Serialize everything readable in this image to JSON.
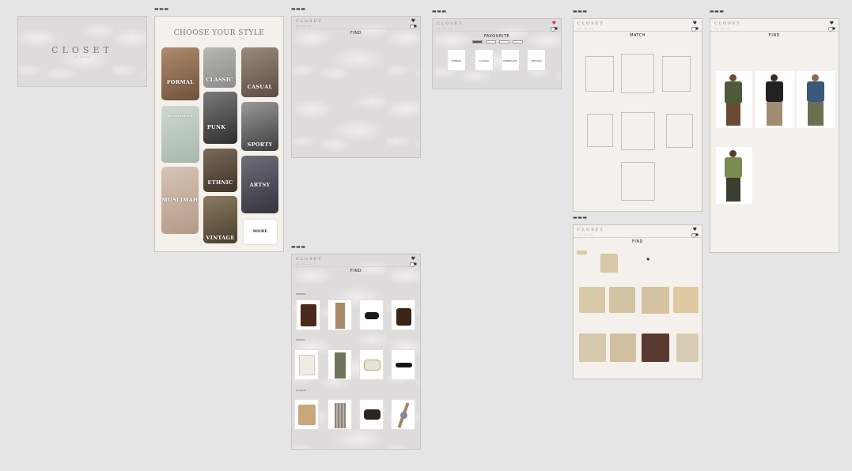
{
  "frames": {
    "splash": {
      "label": "",
      "brand": "CLOSET",
      "brand_sub": "•• •• ••"
    },
    "style": {
      "label": "",
      "title": "CHOOSE YOUR STYLE",
      "tiles": [
        {
          "name": "formal",
          "label": "FORMAL",
          "color": "#8a6a52"
        },
        {
          "name": "classic",
          "label": "CLASSIC",
          "color": "#9a9a96"
        },
        {
          "name": "casual",
          "label": "CASUAL",
          "color": "#7d6d5e"
        },
        {
          "name": "minimalist",
          "label": "MINIMALIST",
          "color": "#b9c7bd"
        },
        {
          "name": "punk",
          "label": "PUNK",
          "color": "#5a5a58"
        },
        {
          "name": "sporty",
          "label": "SPORTY",
          "color": "#6a6a68"
        },
        {
          "name": "muslimah",
          "label": "MUSLIMAH",
          "color": "#c9b3a4"
        },
        {
          "name": "ethnic",
          "label": "ETHNIC",
          "color": "#5b4d3c"
        },
        {
          "name": "artsy",
          "label": "ARTSY",
          "color": "#4f4f58"
        },
        {
          "name": "vintage",
          "label": "VINTAGE",
          "color": "#6a5a44"
        },
        {
          "name": "more",
          "label": "MORE",
          "color": "#ffffff"
        }
      ]
    },
    "find_empty": {
      "label": "",
      "brand": "CLOSET",
      "brand_sub": "•• •• ••",
      "title": "FIND",
      "subtitle": ""
    },
    "favourite": {
      "label": "",
      "brand": "CLOSET",
      "brand_sub": "•• •• ••",
      "title": "FAVOURITE",
      "chips": [
        "",
        "",
        "",
        ""
      ],
      "cards": [
        "FORMAL",
        "CLASSIC",
        "MINIMALIST",
        "VINTAGE"
      ]
    },
    "match": {
      "label": "",
      "brand": "CLOSET",
      "brand_sub": "•• •• ••",
      "title": "MATCH",
      "subtitle": ""
    },
    "find_products": {
      "label": "",
      "brand": "CLOSET",
      "brand_sub": "•• •• ••",
      "title": "FIND",
      "subtitle": "",
      "rows": [
        {
          "label": "FORMAL",
          "items": [
            {
              "name": "blazer",
              "color": "#4a2a1c"
            },
            {
              "name": "trousers",
              "color": "#a88a66"
            },
            {
              "name": "loafers",
              "color": "#1a1a1a"
            },
            {
              "name": "tote-bag",
              "color": "#3a2418"
            }
          ]
        },
        {
          "label": "CASUAL",
          "items": [
            {
              "name": "shirt",
              "color": "#f0ece3"
            },
            {
              "name": "cargo-pants",
              "color": "#6f7558"
            },
            {
              "name": "sneakers",
              "color": "#e6e2d8"
            },
            {
              "name": "sunglasses",
              "color": "#151515"
            }
          ]
        },
        {
          "label": "CLASSIC",
          "items": [
            {
              "name": "cardigan",
              "color": "#c7a77a"
            },
            {
              "name": "plaid-skirt",
              "color": "#8a8378"
            },
            {
              "name": "mary-janes",
              "color": "#2a241e"
            },
            {
              "name": "watch",
              "color": "#7a8a9a"
            }
          ]
        }
      ]
    },
    "find_detail": {
      "label": "",
      "brand": "CLOSET",
      "brand_sub": "•• •• ••",
      "title": "FIND",
      "subtitle": "",
      "item_name": "",
      "item_desc": "",
      "tees": [
        "#d8c8a8",
        "#d2c3a3",
        "#d4c2a0",
        "#e0c8a0",
        "#d6c8ac",
        "#d0c0a0",
        "#5a3a30",
        "#d8ccb4"
      ]
    },
    "find_people": {
      "label": "",
      "brand": "CLOSET",
      "brand_sub": "•• •• ••",
      "title": "FIND",
      "subtitle": "",
      "filter1": "",
      "filter2": "",
      "people": [
        {
          "top": "#4f5a3a",
          "bottom": "#6a4a34"
        },
        {
          "top": "#222222",
          "bottom": "#a08c70"
        },
        {
          "top": "#3a5878",
          "bottom": "#6a7050"
        },
        {
          "top": "#7a8a50",
          "bottom": "#3a3e30"
        }
      ]
    }
  }
}
